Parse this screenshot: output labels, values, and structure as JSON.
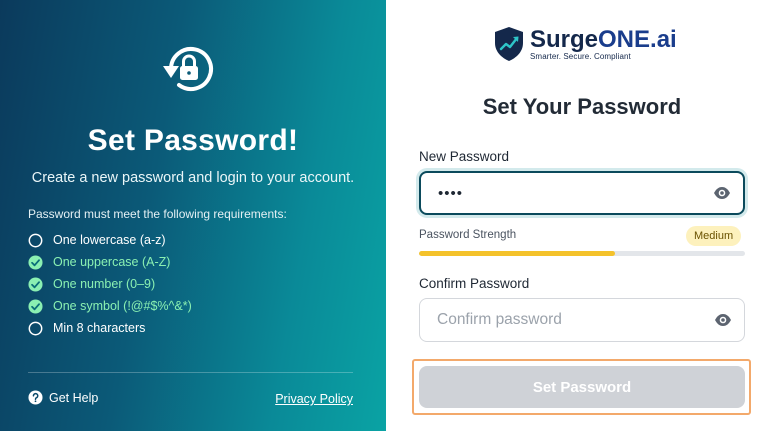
{
  "left": {
    "title": "Set Password!",
    "subtitle": "Create a new password and login to your account.",
    "requirements_heading": "Password must meet the following requirements:",
    "requirements": [
      {
        "label": "One lowercase (a-z)",
        "met": false
      },
      {
        "label": "One uppercase (A-Z)",
        "met": true
      },
      {
        "label": "One number (0–9)",
        "met": true
      },
      {
        "label": "One symbol (!@#$%^&*)",
        "met": true
      },
      {
        "label": "Min 8 characters",
        "met": false
      }
    ],
    "help_label": "Get Help",
    "privacy_label": "Privacy Policy"
  },
  "brand": {
    "name_prefix": "Surge",
    "name_suffix": "ONE.ai",
    "tagline": "Smarter. Secure. Compliant"
  },
  "form": {
    "title": "Set Your Password",
    "new_password": {
      "label": "New Password",
      "value": "••••"
    },
    "strength": {
      "label": "Password Strength",
      "level": "Medium",
      "fraction": 0.6
    },
    "confirm_password": {
      "label": "Confirm Password",
      "placeholder": "Confirm password"
    },
    "submit_label": "Set Password"
  },
  "colors": {
    "accent": "#0b4a5c",
    "met": "#8af0b2",
    "strength_fill": "#f4c22b",
    "disabled_button": "#cfd2d7"
  },
  "icons": {
    "header": "lock-reset-icon",
    "met": "check-circle-icon",
    "unmet": "empty-circle-icon",
    "help": "question-circle-icon",
    "reveal": "eye-icon"
  }
}
